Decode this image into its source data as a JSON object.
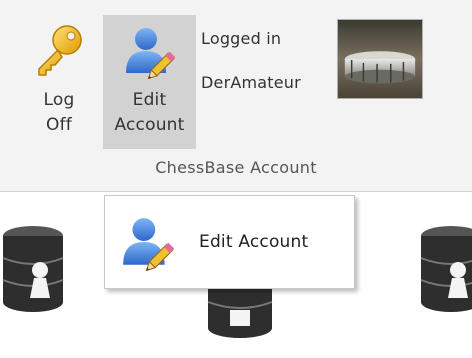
{
  "ribbon": {
    "buttons": [
      {
        "label": "Log\nOff",
        "icon": "key-icon"
      },
      {
        "label": "Edit\nAccount",
        "icon": "user-edit-icon"
      }
    ],
    "status_line1": "Logged in",
    "username": "DerAmateur",
    "group_label": "ChessBase Account",
    "avatar": "snare-drum-photo"
  },
  "popup": {
    "item_label": "Edit Account",
    "item_icon": "user-edit-icon"
  },
  "background_icons": [
    "database-pawn-icon",
    "database-pawn-icon",
    "database-pawn-icon"
  ],
  "colors": {
    "ribbon_bg": "#f3f3f3",
    "selected_button_bg": "#d2d2d2",
    "text": "#333333",
    "user_icon_blue": "#3a7ad9",
    "key_gold": "#f2b010"
  }
}
